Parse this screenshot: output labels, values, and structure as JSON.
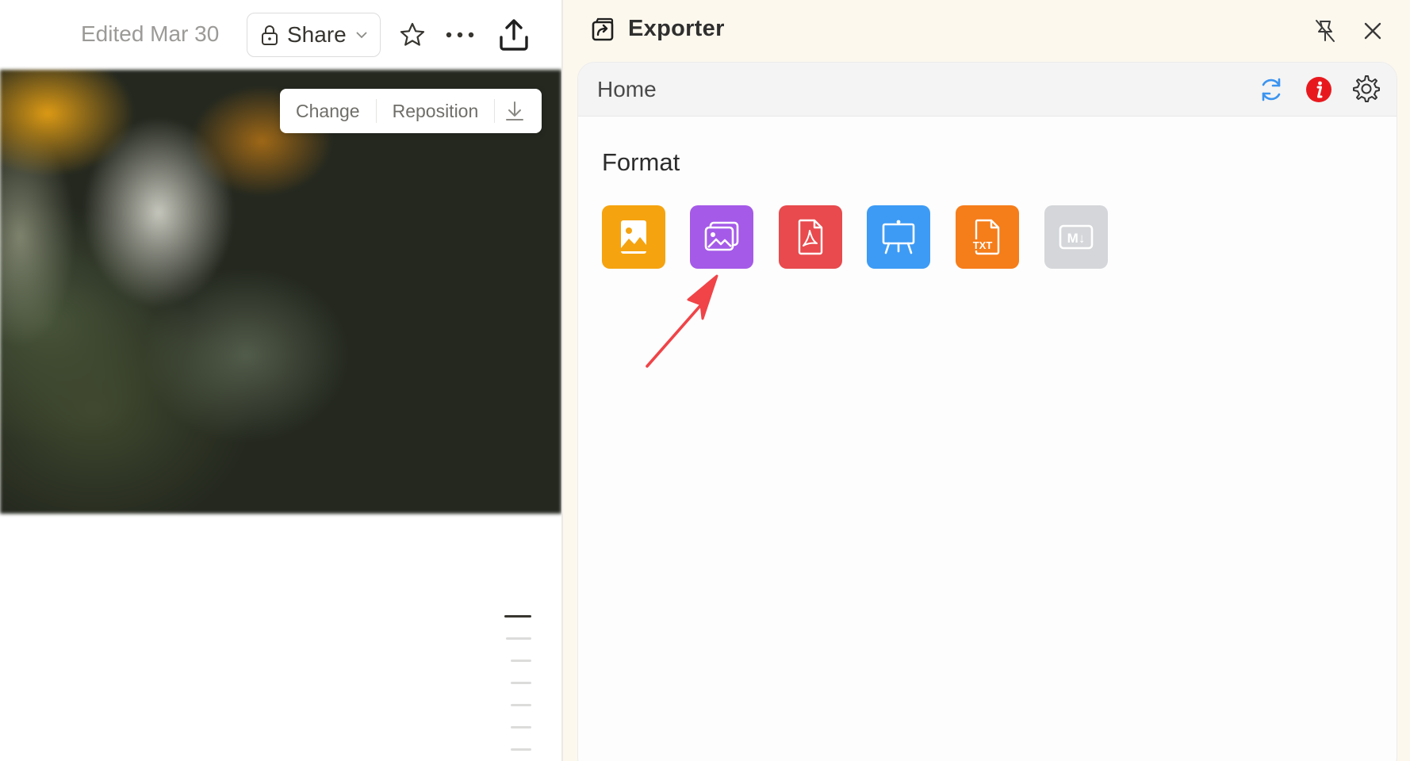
{
  "document": {
    "edited_text": "Edited Mar 30",
    "share_label": "Share",
    "cover_toolbar": {
      "change_label": "Change",
      "reposition_label": "Reposition"
    }
  },
  "exporter": {
    "title": "Exporter",
    "breadcrumb": "Home",
    "format_heading": "Format",
    "formats": [
      {
        "icon": "image-icon",
        "color": "#f5a30f"
      },
      {
        "icon": "images-icon",
        "color": "#a55ae8"
      },
      {
        "icon": "pdf-icon",
        "color": "#e84a4d"
      },
      {
        "icon": "presentation-icon",
        "color": "#3d9bf5"
      },
      {
        "icon": "txt-file-icon",
        "color": "#f57d1a",
        "glyph_text": "TXT"
      },
      {
        "icon": "markdown-icon",
        "color": "#d4d6d9",
        "glyph_text": "M↓"
      }
    ]
  },
  "colors": {
    "exporter_background": "#fcf8ee",
    "annotation_arrow": "#f04448",
    "info_badge": "#e8191e",
    "refresh": "#3b94f0"
  }
}
